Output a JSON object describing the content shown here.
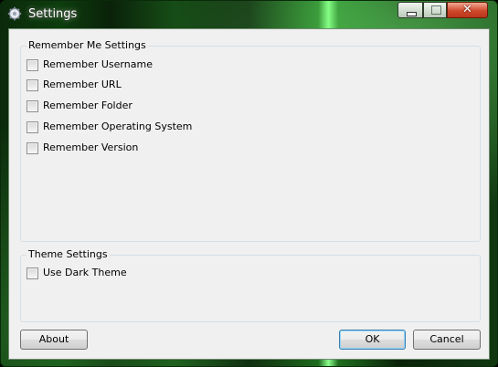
{
  "window": {
    "title": "Settings"
  },
  "remember_group": {
    "label": "Remember Me Settings",
    "items": [
      {
        "label": "Remember Username",
        "checked": false
      },
      {
        "label": "Remember URL",
        "checked": false
      },
      {
        "label": "Remember Folder",
        "checked": false
      },
      {
        "label": "Remember Operating System",
        "checked": false
      },
      {
        "label": "Remember Version",
        "checked": false
      }
    ]
  },
  "theme_group": {
    "label": "Theme Settings",
    "items": [
      {
        "label": "Use Dark Theme",
        "checked": false
      }
    ]
  },
  "buttons": {
    "about": "About",
    "ok": "OK",
    "cancel": "Cancel"
  },
  "icons": {
    "app": "gear-icon",
    "minimize": "minimize-icon",
    "maximize": "maximize-icon",
    "close": "close-icon"
  }
}
